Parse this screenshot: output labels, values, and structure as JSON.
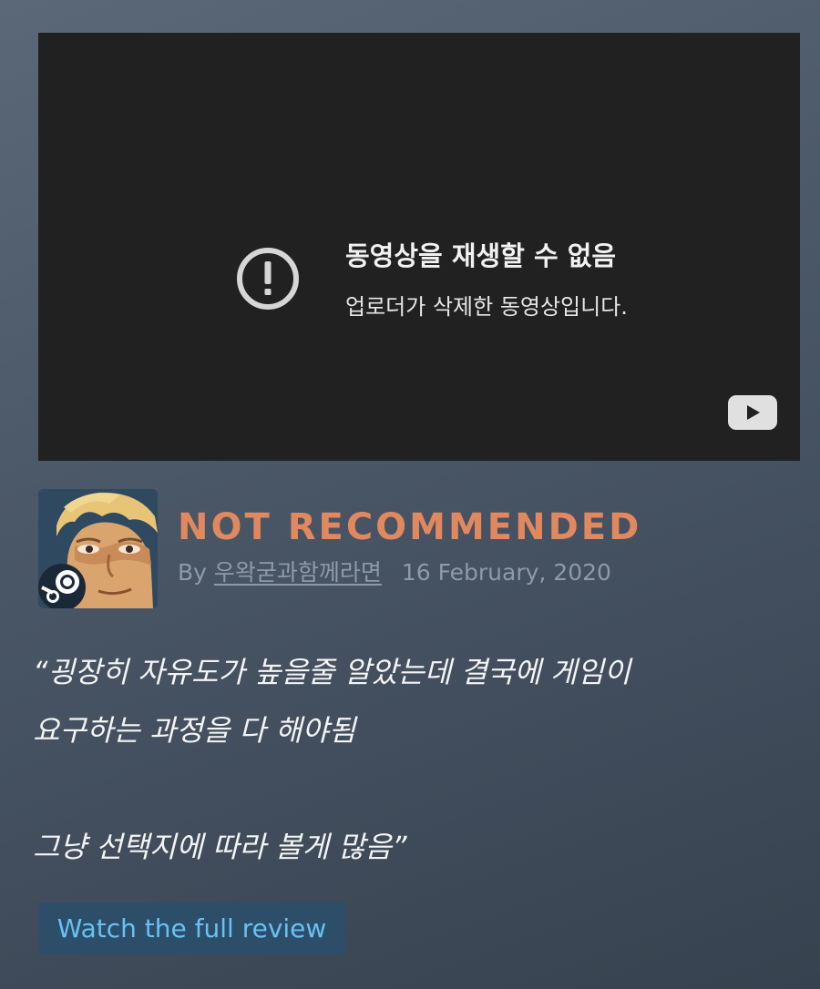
{
  "video": {
    "error_title": "동영상을 재생할 수 없음",
    "error_message": "업로더가 삭제한 동영상입니다.",
    "error_icon": "alert-circle-icon",
    "logo_icon": "youtube-logo-icon"
  },
  "review": {
    "verdict": "NOT RECOMMENDED",
    "by_label": "By",
    "author": "우왁굳과함께라면",
    "date": "16 February, 2020",
    "quote": "“굉장히 자유도가 높을줄 알았는데 결국에 게임이\n요구하는 과정을 다 해야됨\n\n그냥 선택지에 따라 볼게 많음”",
    "watch_button": "Watch the full review"
  },
  "colors": {
    "verdict": "#e1885e",
    "link": "#67c1f5",
    "button_bg": "#2d4e68",
    "video_bg": "#212121"
  }
}
